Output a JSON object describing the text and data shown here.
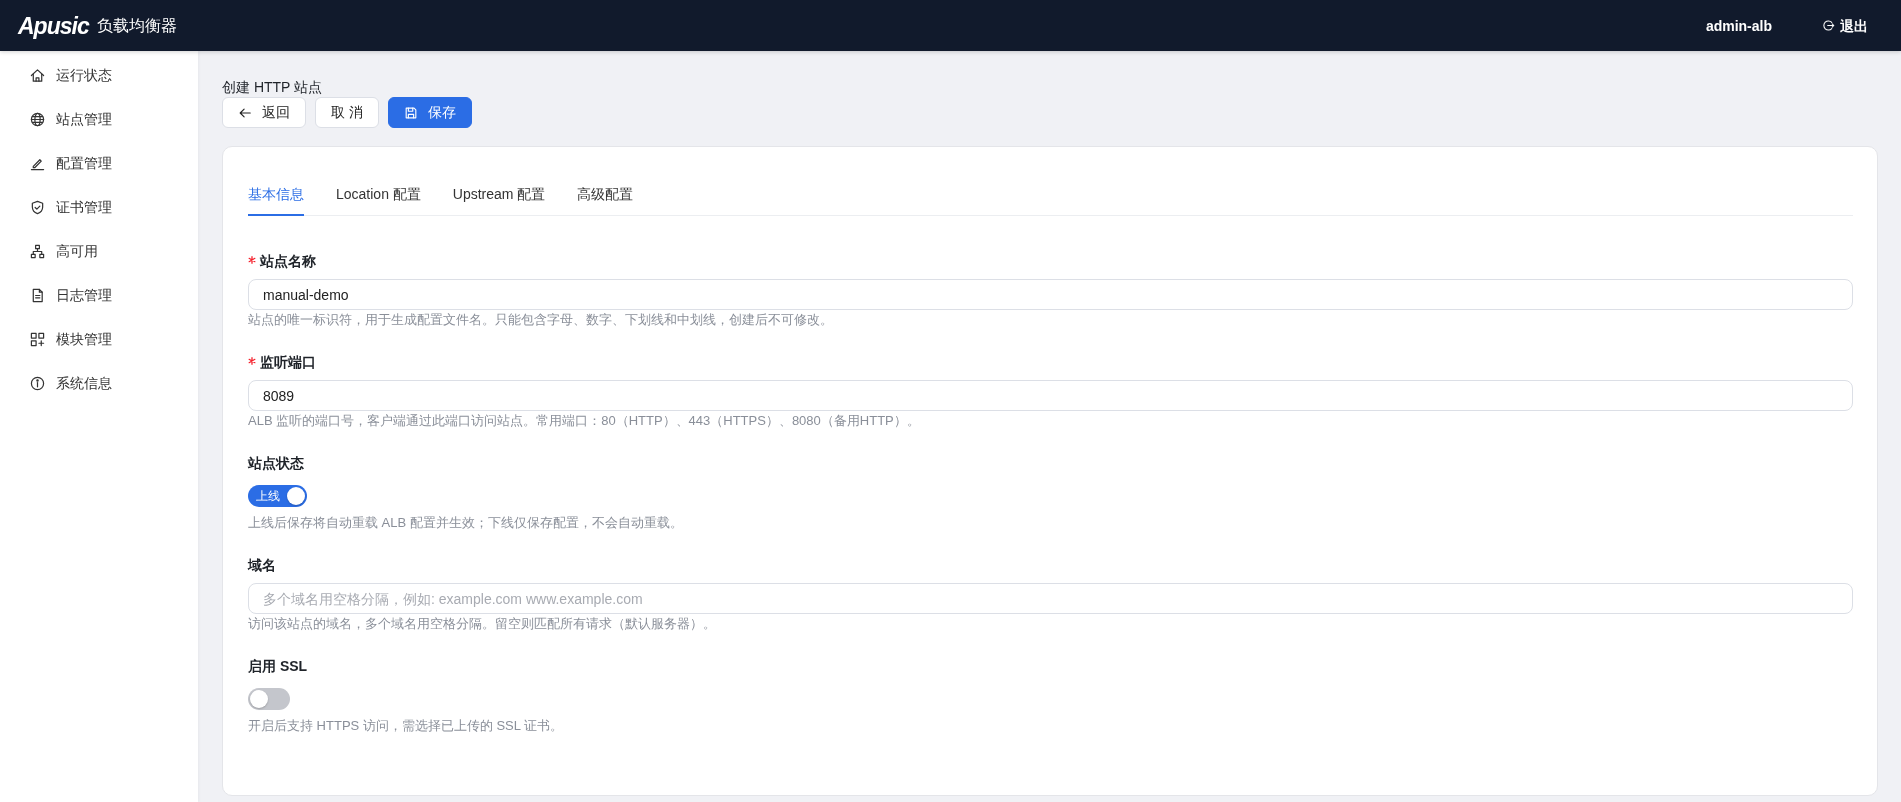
{
  "header": {
    "logo": "Apusic",
    "product": "负载均衡器",
    "user": "admin-alb",
    "logout": "退出"
  },
  "sidebar": {
    "items": [
      {
        "label": "运行状态",
        "selected": false
      },
      {
        "label": "站点管理",
        "selected": false
      },
      {
        "label": "配置管理",
        "selected": false
      },
      {
        "label": "证书管理",
        "selected": false
      },
      {
        "label": "高可用",
        "selected": false
      },
      {
        "label": "日志管理",
        "selected": false
      },
      {
        "label": "模块管理",
        "selected": false
      },
      {
        "label": "系统信息",
        "selected": false
      }
    ]
  },
  "page": {
    "title": "创建 HTTP 站点",
    "buttons": [
      {
        "kind": "back",
        "label": "返回"
      },
      {
        "kind": "plain",
        "label": "取 消"
      },
      {
        "kind": "save",
        "label": "保存"
      }
    ],
    "tabs": [
      {
        "label": "基本信息",
        "selected": true
      },
      {
        "label": "Location 配置",
        "selected": false
      },
      {
        "label": "Upstream 配置",
        "selected": false
      },
      {
        "label": "高级配置",
        "selected": false
      }
    ],
    "fields": [
      {
        "kind": "text",
        "label": "站点名称",
        "required": true,
        "value": "manual-demo",
        "help": "站点的唯一标识符，用于生成配置文件名。只能包含字母、数字、下划线和中划线，创建后不可修改。"
      },
      {
        "kind": "text",
        "label": "监听端口",
        "required": true,
        "value": "8089",
        "help": "ALB 监听的端口号，客户端通过此端口访问站点。常用端口：80（HTTP）、443（HTTPS）、8080（备用HTTP）。"
      },
      {
        "kind": "switch",
        "label": "站点状态",
        "required": false,
        "on": true,
        "text": "上线",
        "help": "上线后保存将自动重载 ALB 配置并生效；下线仅保存配置，不会自动重载。"
      },
      {
        "kind": "text",
        "label": "域名",
        "required": false,
        "placeholder": "多个域名用空格分隔，例如: example.com www.example.com",
        "help": "访问该站点的域名，多个域名用空格分隔。留空则匹配所有请求（默认服务器）。"
      },
      {
        "kind": "switch",
        "label": "启用 SSL",
        "required": false,
        "on": false,
        "help": "开启后支持 HTTPS 访问，需选择已上传的 SSL 证书。"
      }
    ]
  }
}
